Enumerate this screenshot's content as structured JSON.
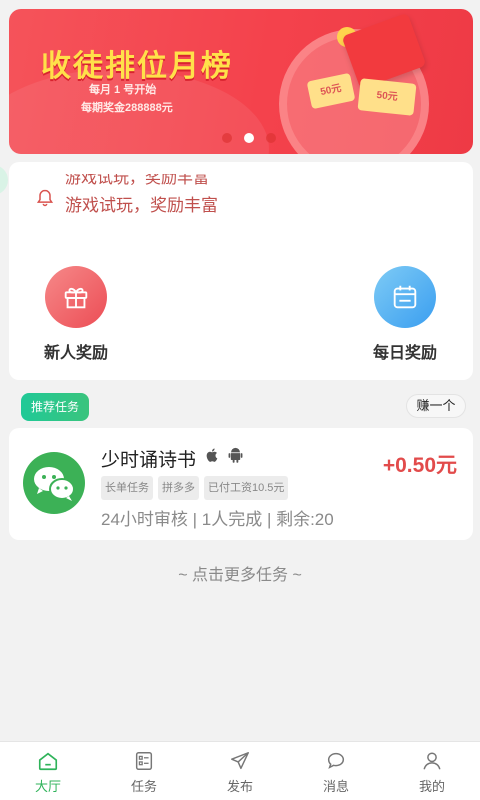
{
  "banner": {
    "title": "收徒排位月榜",
    "sub1": "每月 1 号开始",
    "sub2": "每期奖金288888元",
    "ticket1": "50元",
    "ticket2": "50元",
    "current_slide": 2,
    "slide_count": 3
  },
  "notice": {
    "previous": "游戏试玩，奖励丰富",
    "current": "游戏试玩，奖励丰富"
  },
  "features": [
    {
      "label": "新人奖励",
      "icon": "gift-icon",
      "color": "#ec4d55"
    },
    {
      "label": "每日奖励",
      "icon": "calendar-icon",
      "color": "#3a9ef0"
    }
  ],
  "recommend": {
    "tag": "推荐任务",
    "earn_button": "赚一个"
  },
  "task": {
    "name": "少时诵诗书",
    "price": "+0.50元",
    "chips": [
      "长单任务",
      "拼多多",
      "已付工资10.5元"
    ],
    "meta": "24小时审核 | 1人完成 | 剩余:20",
    "platforms": [
      "apple-icon",
      "android-icon"
    ]
  },
  "more_link": "~ 点击更多任务 ~",
  "tabbar": {
    "items": [
      {
        "label": "大厅",
        "icon": "home-icon",
        "active": true
      },
      {
        "label": "任务",
        "icon": "task-list-icon",
        "active": false
      },
      {
        "label": "发布",
        "icon": "send-icon",
        "active": false
      },
      {
        "label": "消息",
        "icon": "chat-icon",
        "active": false
      },
      {
        "label": "我的",
        "icon": "user-icon",
        "active": false
      }
    ]
  },
  "colors": {
    "accent": "#2fb35a",
    "price": "#e24b4b",
    "notice": "#c0504d",
    "banner": "#f4424c"
  }
}
